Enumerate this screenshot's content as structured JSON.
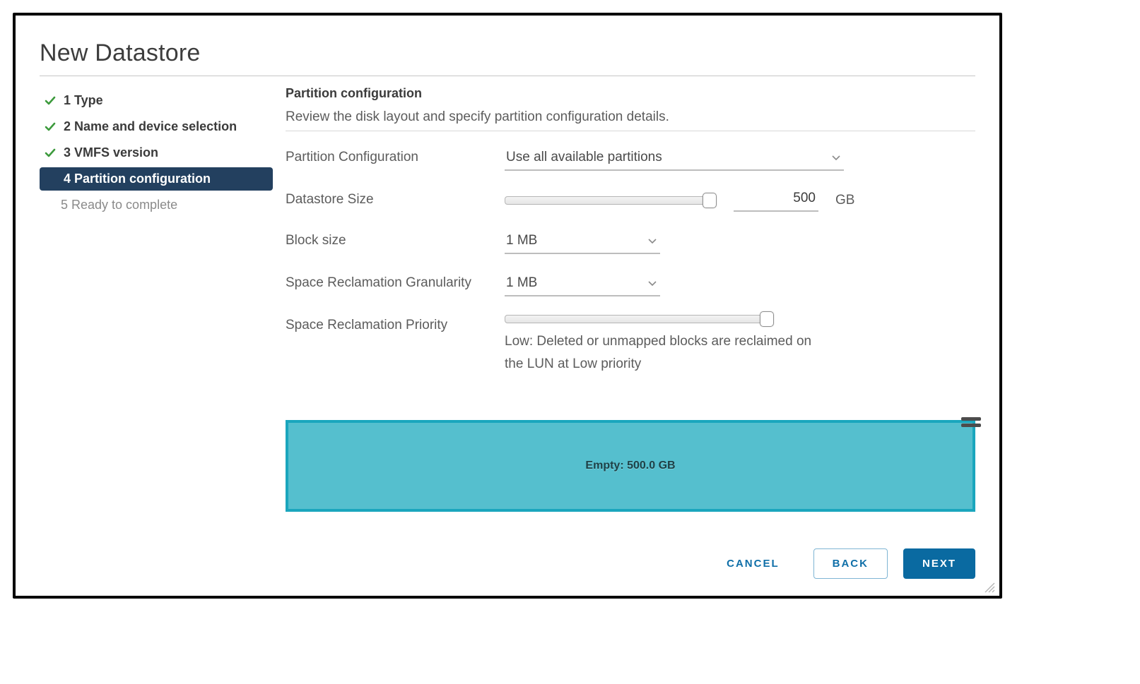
{
  "dialog": {
    "title": "New Datastore"
  },
  "steps": {
    "s1": {
      "label": "1 Type"
    },
    "s2": {
      "label": "2 Name and device selection"
    },
    "s3": {
      "label": "3 VMFS version"
    },
    "s4": {
      "label": "4 Partition configuration"
    },
    "s5": {
      "label": "5 Ready to complete"
    }
  },
  "pane": {
    "title": "Partition configuration",
    "desc": "Review the disk layout and specify partition configuration details."
  },
  "form": {
    "partition_config": {
      "label": "Partition Configuration",
      "value": "Use all available partitions"
    },
    "datastore_size": {
      "label": "Datastore Size",
      "value": "500",
      "unit": "GB"
    },
    "block_size": {
      "label": "Block size",
      "value": "1 MB"
    },
    "reclaim_gran": {
      "label": "Space Reclamation Granularity",
      "value": "1 MB"
    },
    "reclaim_prio": {
      "label": "Space Reclamation Priority",
      "desc": "Low: Deleted or unmapped blocks are reclaimed on the LUN at Low priority"
    }
  },
  "disk": {
    "segment_label": "Empty: 500.0 GB"
  },
  "footer": {
    "cancel": "CANCEL",
    "back": "BACK",
    "next": "NEXT"
  },
  "colors": {
    "accent": "#0a6aa1",
    "step_active_bg": "#23405f",
    "disk_fill": "#55bfce",
    "disk_border": "#1aa6bd",
    "check_green": "#3c9a3c"
  }
}
